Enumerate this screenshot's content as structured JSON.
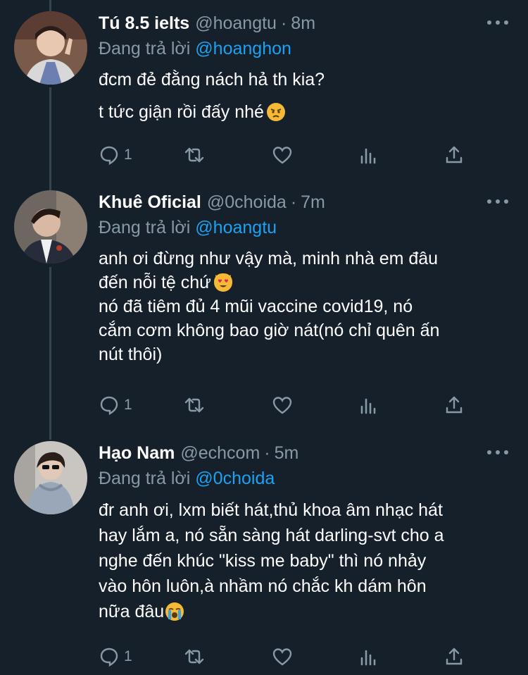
{
  "tweets": [
    {
      "name": "Tú 8.5 ielts",
      "handle": "@hoangtu",
      "time": "8m",
      "reply_label": "Đang trả lời",
      "reply_to": "@hoanghon",
      "lines": [
        "đcm đẻ đằng nách hả th kia?",
        "t tức giận rồi đấy nhé"
      ],
      "emoji": "angry-face-emoji",
      "reply_count": "1"
    },
    {
      "name": "Khuê Oficial",
      "handle": "@0choida",
      "time": "7m",
      "reply_label": "Đang trả lời",
      "reply_to": "@hoangtu",
      "lines": [
        "anh ơi đừng như vậy mà, minh nhà em đâu",
        "đến nỗi tệ chứ",
        "nó đã tiêm đủ 4 mũi vaccine covid19, nó",
        "cắm cơm không bao giờ nát(nó chỉ quên ấn",
        "nút thôi)"
      ],
      "emoji": "heart-eyes-cat-emoji",
      "reply_count": "1"
    },
    {
      "name": "Hạo Nam",
      "handle": "@echcom",
      "time": "5m",
      "reply_label": "Đang trả lời",
      "reply_to": "@0choida",
      "lines": [
        "đr anh ơi, lxm biết hát,thủ khoa âm nhạc hát",
        "hay lắm a, nó sẵn sàng hát darling-svt cho a",
        "nghe đến khúc \"kiss me baby\" thì nó nhảy",
        "vào hôn luôn,à nhầm nó chắc kh dám hôn",
        "nữa đâu"
      ],
      "emoji": "loudly-crying-emoji",
      "reply_count": "1"
    }
  ],
  "colors": {
    "background": "#15202b",
    "secondary_text": "#8899a6",
    "link": "#1da1f2",
    "thread_line": "#38444d"
  },
  "icons": [
    "comment-icon",
    "retweet-icon",
    "like-icon",
    "analytics-icon",
    "share-icon",
    "more-icon"
  ]
}
